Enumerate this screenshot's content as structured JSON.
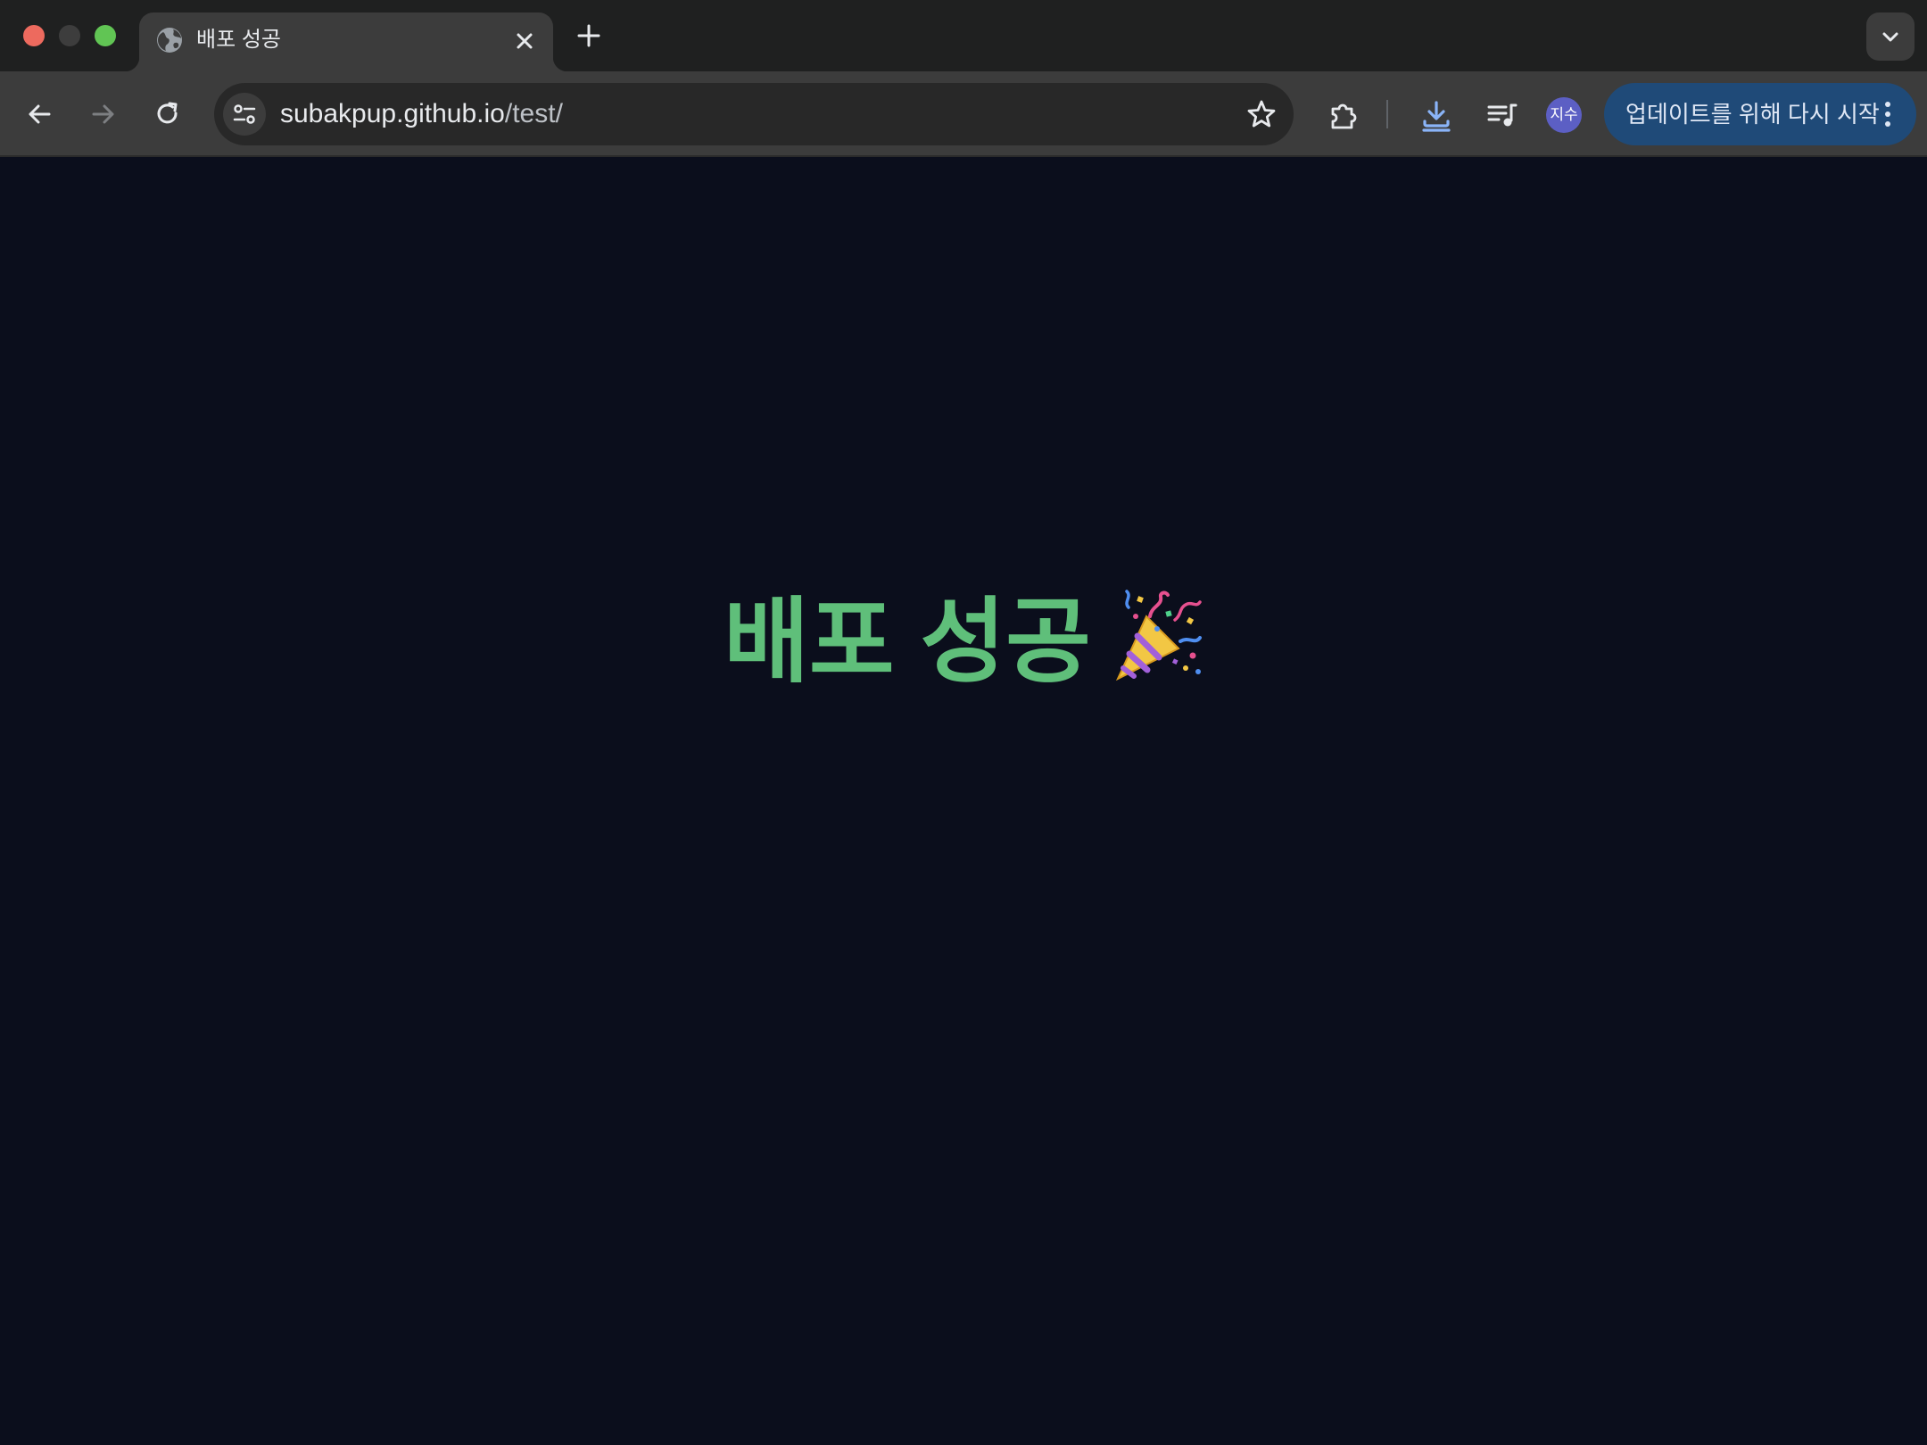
{
  "window": {
    "traffic_lights": {
      "close_color": "#ed6a5e",
      "minimize_color": "#3d3d3d",
      "maximize_color": "#61c554"
    }
  },
  "tab": {
    "title": "배포 성공",
    "favicon": "globe-icon"
  },
  "toolbar": {
    "back_icon": "arrow-left-icon",
    "forward_icon": "arrow-right-icon",
    "reload_icon": "reload-icon",
    "url_host": "subakpup.github.io",
    "url_path": "/test/",
    "profile_initials": "지수",
    "update_label": "업데이트를 위해 다시 시작"
  },
  "page": {
    "heading": "배포 성공",
    "heading_emoji": "party-popper-icon",
    "heading_color": "#5fbf7a",
    "background_color": "#0b0e1c"
  }
}
